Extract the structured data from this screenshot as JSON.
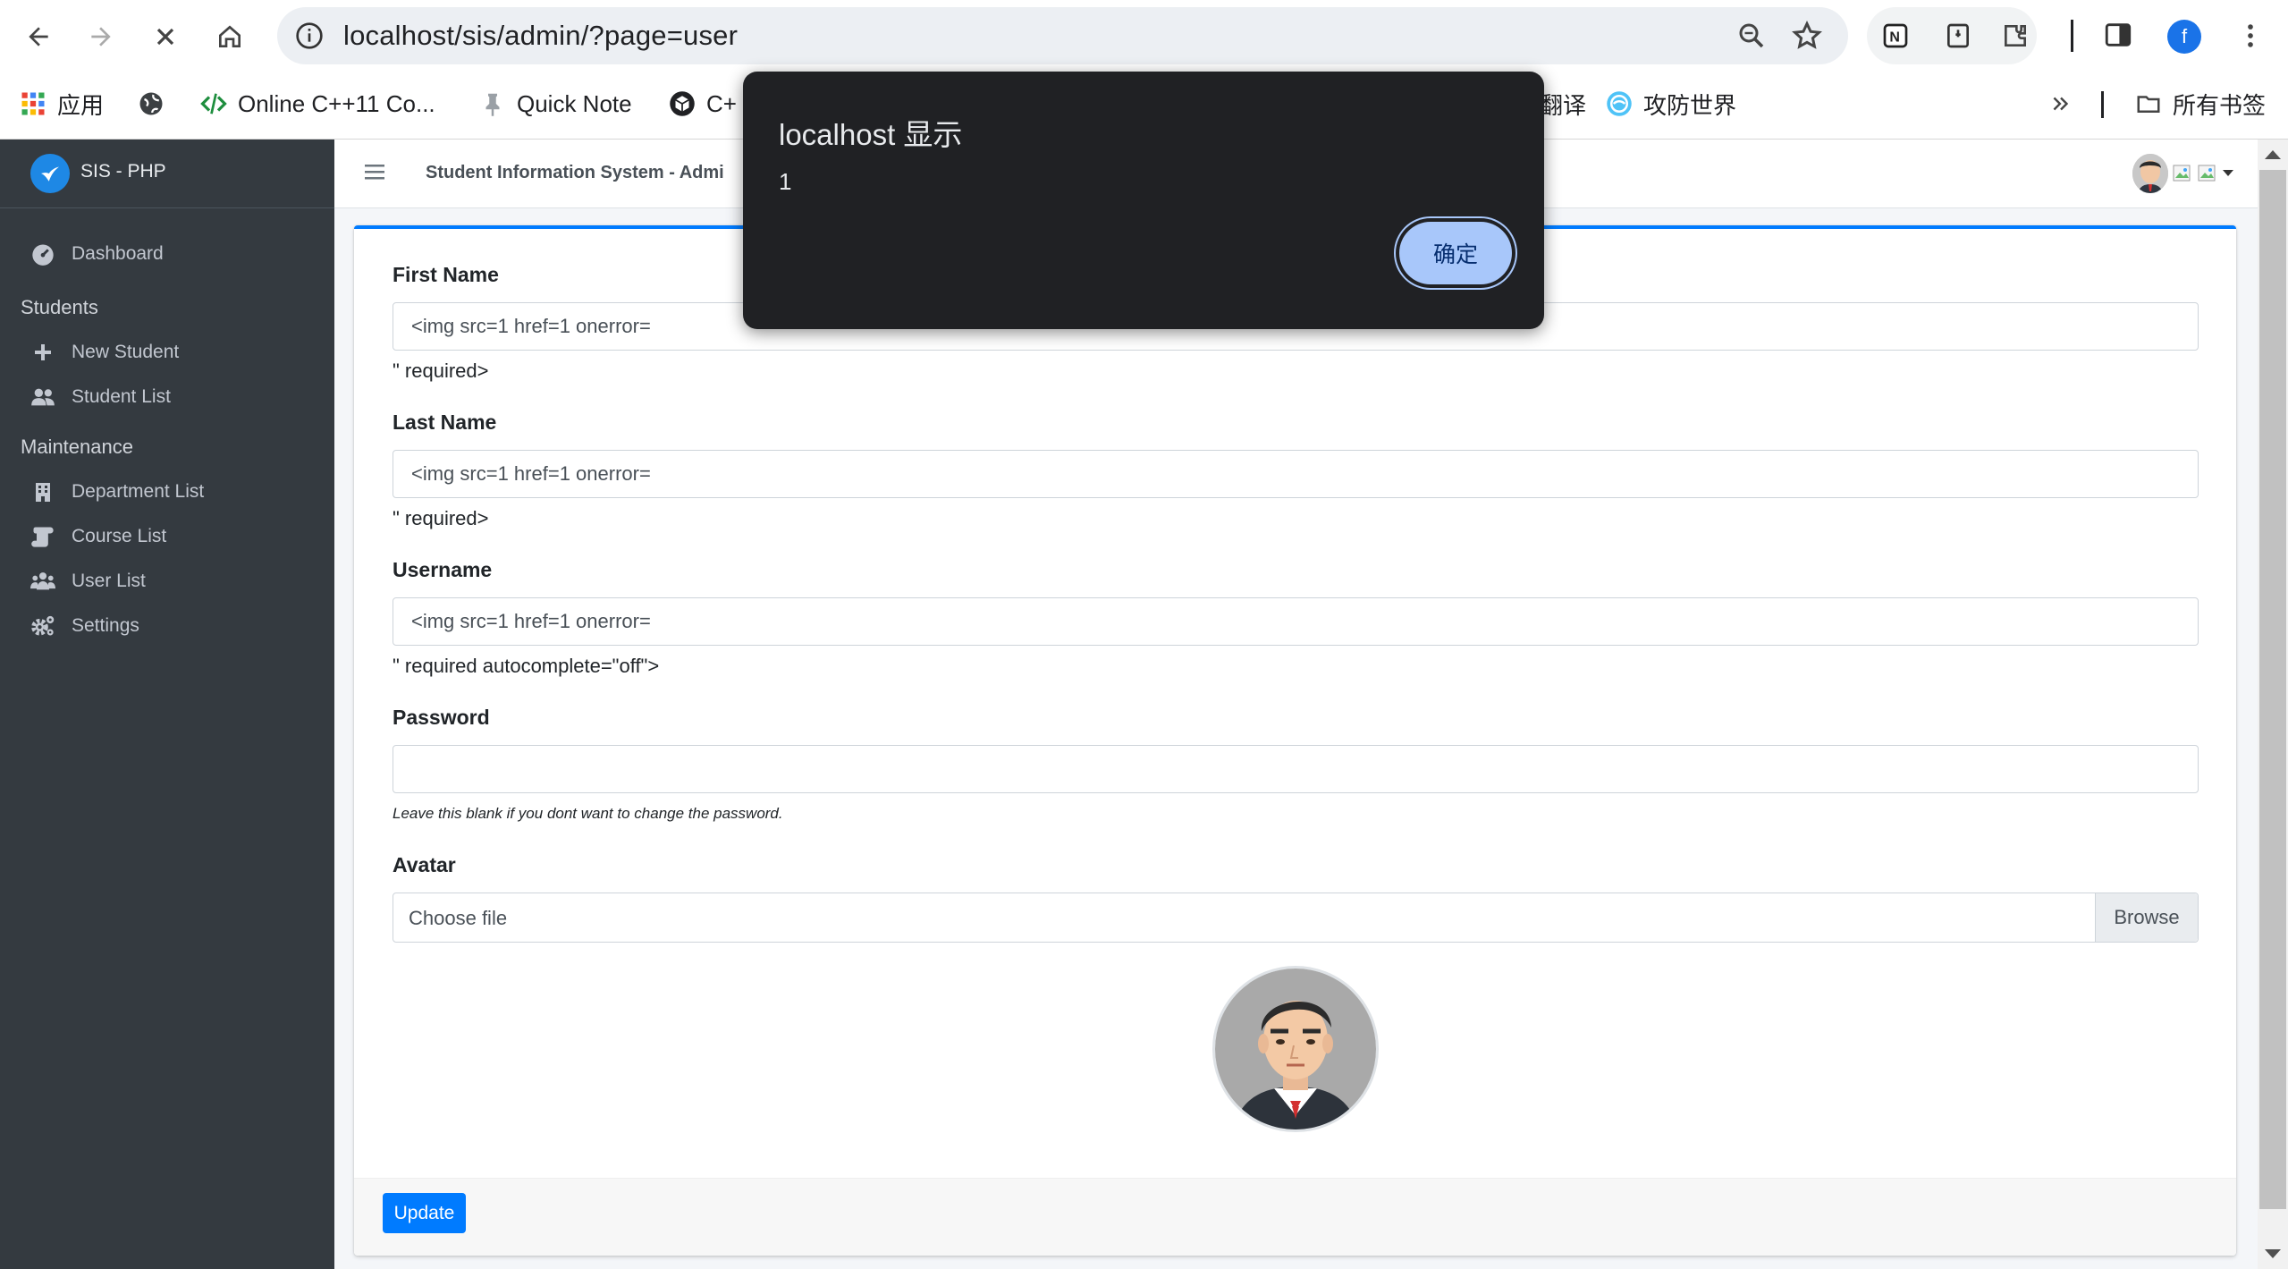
{
  "browser": {
    "url": "localhost/sis/admin/?page=user",
    "profile_initial": "f",
    "bookmarks": {
      "apps": "应用",
      "online_cpp": "Online C++11 Co...",
      "quick_note": "Quick Note",
      "cpp_partial": "C+",
      "translate_partial": "翻译",
      "gongfang": "攻防世界",
      "all_bookmarks": "所有书签"
    }
  },
  "dialog": {
    "title": "localhost 显示",
    "message": "1",
    "ok_label": "确定"
  },
  "sidebar": {
    "brand": "SIS - PHP",
    "dashboard": "Dashboard",
    "students_header": "Students",
    "new_student": "New Student",
    "student_list": "Student List",
    "maintenance_header": "Maintenance",
    "department_list": "Department List",
    "course_list": "Course List",
    "user_list": "User List",
    "settings": "Settings"
  },
  "topbar": {
    "title": "Student Information System - Admi"
  },
  "form": {
    "first_name": {
      "label": "First Name",
      "value": "<img src=1 href=1 onerror=",
      "trailing": "\" required>"
    },
    "last_name": {
      "label": "Last Name",
      "value": "<img src=1 href=1 onerror=",
      "trailing": "\" required>"
    },
    "username": {
      "label": "Username",
      "value": "<img src=1 href=1 onerror=",
      "trailing": "\" required autocomplete=\"off\">"
    },
    "password": {
      "label": "Password",
      "value": "",
      "hint": "Leave this blank if you dont want to change the password."
    },
    "avatar": {
      "label": "Avatar",
      "choose": "Choose file",
      "browse": "Browse"
    },
    "update_label": "Update"
  },
  "colors": {
    "primary": "#007bff",
    "sidebar_bg": "#343a40",
    "dialog_bg": "#202124",
    "dialog_button": "#a8c7fa"
  }
}
